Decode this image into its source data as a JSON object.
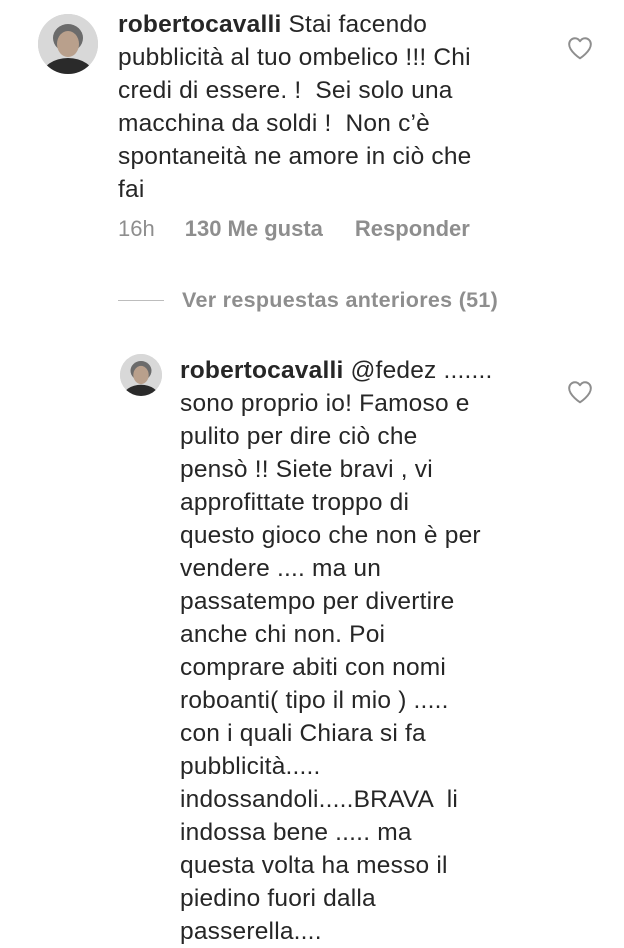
{
  "main_comment": {
    "username": "robertocavalli",
    "lines": [
      " Stai facendo",
      "pubblicità al tuo ombelico !!! Chi",
      "credi di essere. !  Sei solo una",
      "macchina da soldi !  Non c’è",
      "spontaneità ne amore in ciò che",
      "fai"
    ],
    "time": "16h",
    "likes": "130 Me gusta",
    "reply_label": "Responder"
  },
  "view_previous_replies": "Ver respuestas anteriores (51)",
  "reply": {
    "username": "robertocavalli",
    "lines": [
      " @fedez .......",
      "sono proprio io! Famoso e",
      "pulito per dire ciò che",
      "pensò !! Siete bravi , vi",
      "approfittate troppo di",
      "questo gioco che non è per",
      "vendere .... ma un",
      "passatempo per divertire",
      "anche chi non. Poi",
      "comprare abiti con nomi",
      "roboanti( tipo il mio ) .....",
      "con i quali Chiara si fa",
      "pubblicità.....",
      "indossandoli.....BRAVA  li",
      "indossa bene ..... ma",
      "questa volta ha messo il",
      "piedino fuori dalla",
      "passerella...."
    ]
  },
  "icons": {
    "like": "heart-outline-icon",
    "avatar": "profile-photo"
  },
  "colors": {
    "text": "#262626",
    "muted": "#8e8e8e"
  }
}
